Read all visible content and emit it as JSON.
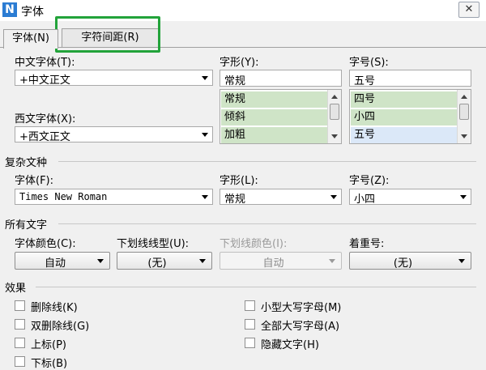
{
  "window": {
    "title": "字体",
    "app_icon": "N",
    "close_symbol": "✕"
  },
  "tabs": [
    {
      "label": "字体(N)",
      "active": true
    },
    {
      "label": "字符间距(R)",
      "active": false
    }
  ],
  "chinese_font": {
    "label": "中文字体(T):",
    "value": "+中文正文"
  },
  "western_font": {
    "label": "西文字体(X):",
    "value": "+西文正文"
  },
  "style": {
    "label": "字形(Y):",
    "value": "常规",
    "options": [
      "常规",
      "倾斜",
      "加粗"
    ]
  },
  "size": {
    "label": "字号(S):",
    "value": "五号",
    "options": [
      "四号",
      "小四",
      "五号"
    ]
  },
  "complex": {
    "section_title": "复杂文种",
    "font_label": "字体(F):",
    "font_value": "Times New Roman",
    "style_label": "字形(L):",
    "style_value": "常规",
    "size_label": "字号(Z):",
    "size_value": "小四"
  },
  "all_text": {
    "section_title": "所有文字",
    "color_label": "字体颜色(C):",
    "color_value": "自动",
    "underline_type_label": "下划线线型(U):",
    "underline_type_value": "(无)",
    "underline_color_label": "下划线颜色(I):",
    "underline_color_value": "自动",
    "emphasis_label": "着重号:",
    "emphasis_value": "(无)"
  },
  "effects": {
    "section_title": "效果",
    "left": [
      "删除线(K)",
      "双删除线(G)",
      "上标(P)",
      "下标(B)"
    ],
    "right": [
      "小型大写字母(M)",
      "全部大写字母(A)",
      "隐藏文字(H)"
    ]
  },
  "colors": {
    "highlight": "#22a33a",
    "list_green": "#cfe4c7",
    "list_selected": "#dbe8f8"
  }
}
